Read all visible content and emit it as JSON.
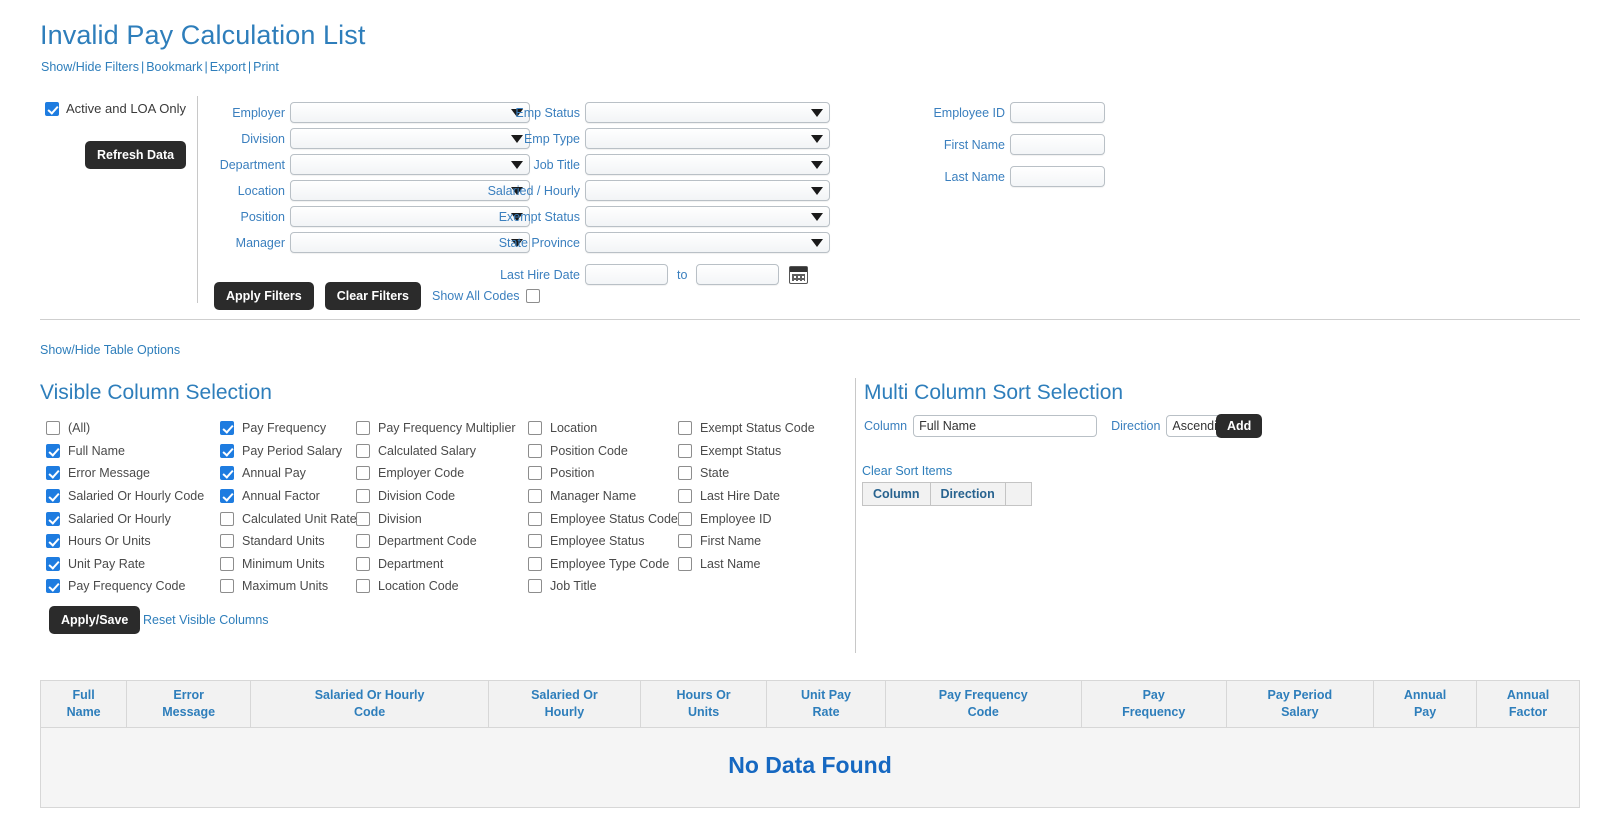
{
  "header": {
    "title": "Invalid Pay Calculation List",
    "links": [
      "Show/Hide Filters",
      "Bookmark",
      "Export",
      "Print"
    ],
    "separator": "|"
  },
  "filters": {
    "active_loa_label": "Active and LOA Only",
    "active_loa_checked": true,
    "refresh_label": "Refresh Data",
    "column1": [
      {
        "label": "Employer",
        "value": ""
      },
      {
        "label": "Division",
        "value": ""
      },
      {
        "label": "Department",
        "value": ""
      },
      {
        "label": "Location",
        "value": ""
      },
      {
        "label": "Position",
        "value": ""
      },
      {
        "label": "Manager",
        "value": ""
      }
    ],
    "column2": [
      {
        "label": "Emp Status",
        "value": ""
      },
      {
        "label": "Emp Type",
        "value": ""
      },
      {
        "label": "Job Title",
        "value": ""
      },
      {
        "label": "Salaried / Hourly",
        "value": ""
      },
      {
        "label": "Exempt Status",
        "value": ""
      },
      {
        "label": "State Province",
        "value": ""
      }
    ],
    "last_hire_date": {
      "label": "Last Hire Date",
      "from": "",
      "to_word": "to",
      "to": "",
      "calendar_icon": "calendar-icon"
    },
    "column3": [
      {
        "label": "Employee ID",
        "value": ""
      },
      {
        "label": "First Name",
        "value": ""
      },
      {
        "label": "Last Name",
        "value": ""
      }
    ],
    "apply_label": "Apply Filters",
    "clear_label": "Clear Filters",
    "show_all_codes_label": "Show All Codes",
    "show_all_codes_checked": false
  },
  "table_options_link": "Show/Hide Table Options",
  "visible_columns": {
    "title": "Visible Column Selection",
    "col1": [
      {
        "label": "(All)",
        "checked": false
      },
      {
        "label": "Full Name",
        "checked": true
      },
      {
        "label": "Error Message",
        "checked": true
      },
      {
        "label": "Salaried Or Hourly Code",
        "checked": true
      },
      {
        "label": "Salaried Or Hourly",
        "checked": true
      },
      {
        "label": "Hours Or Units",
        "checked": true
      },
      {
        "label": "Unit Pay Rate",
        "checked": true
      },
      {
        "label": "Pay Frequency Code",
        "checked": true
      }
    ],
    "col2": [
      {
        "label": "Pay Frequency",
        "checked": true
      },
      {
        "label": "Pay Period Salary",
        "checked": true
      },
      {
        "label": "Annual Pay",
        "checked": true
      },
      {
        "label": "Annual Factor",
        "checked": true
      },
      {
        "label": "Calculated Unit Rate",
        "checked": false
      },
      {
        "label": "Standard Units",
        "checked": false
      },
      {
        "label": "Minimum Units",
        "checked": false
      },
      {
        "label": "Maximum Units",
        "checked": false
      }
    ],
    "col3": [
      {
        "label": "Pay Frequency Multiplier",
        "checked": false
      },
      {
        "label": "Calculated Salary",
        "checked": false
      },
      {
        "label": "Employer Code",
        "checked": false
      },
      {
        "label": "Division Code",
        "checked": false
      },
      {
        "label": "Division",
        "checked": false
      },
      {
        "label": "Department Code",
        "checked": false
      },
      {
        "label": "Department",
        "checked": false
      },
      {
        "label": "Location Code",
        "checked": false
      }
    ],
    "col4": [
      {
        "label": "Location",
        "checked": false
      },
      {
        "label": "Position Code",
        "checked": false
      },
      {
        "label": "Position",
        "checked": false
      },
      {
        "label": "Manager Name",
        "checked": false
      },
      {
        "label": "Employee Status Code",
        "checked": false
      },
      {
        "label": "Employee Status",
        "checked": false
      },
      {
        "label": "Employee Type Code",
        "checked": false
      },
      {
        "label": "Job Title",
        "checked": false
      }
    ],
    "col5": [
      {
        "label": "Exempt Status Code",
        "checked": false
      },
      {
        "label": "Exempt Status",
        "checked": false
      },
      {
        "label": "State",
        "checked": false
      },
      {
        "label": "Last Hire Date",
        "checked": false
      },
      {
        "label": "Employee ID",
        "checked": false
      },
      {
        "label": "First Name",
        "checked": false
      },
      {
        "label": "Last Name",
        "checked": false
      }
    ],
    "apply_save_label": "Apply/Save",
    "reset_label": "Reset Visible Columns"
  },
  "sort": {
    "title": "Multi Column Sort Selection",
    "column_label": "Column",
    "column_value": "Full Name",
    "direction_label": "Direction",
    "direction_value": "Ascending",
    "add_label": "Add",
    "clear_label": "Clear Sort Items",
    "table_headers": [
      "Column",
      "Direction"
    ],
    "rows": []
  },
  "data_table": {
    "headers": [
      {
        "line1": "Full",
        "line2": "Name"
      },
      {
        "line1": "Error",
        "line2": "Message"
      },
      {
        "line1": "Salaried Or Hourly",
        "line2": "Code"
      },
      {
        "line1": "Salaried Or",
        "line2": "Hourly"
      },
      {
        "line1": "Hours Or",
        "line2": "Units"
      },
      {
        "line1": "Unit Pay",
        "line2": "Rate"
      },
      {
        "line1": "Pay Frequency",
        "line2": "Code"
      },
      {
        "line1": "Pay",
        "line2": "Frequency"
      },
      {
        "line1": "Pay Period",
        "line2": "Salary"
      },
      {
        "line1": "Annual",
        "line2": "Pay"
      },
      {
        "line1": "Annual",
        "line2": "Factor"
      }
    ],
    "empty_message": "No Data Found",
    "rows": []
  },
  "colors": {
    "accent_blue": "#2e7ebb",
    "label_blue": "#3a7fbe",
    "checkbox_blue": "#1e7ce0",
    "button_dark": "#2b2b2b",
    "nodata_blue": "#1668c1"
  }
}
